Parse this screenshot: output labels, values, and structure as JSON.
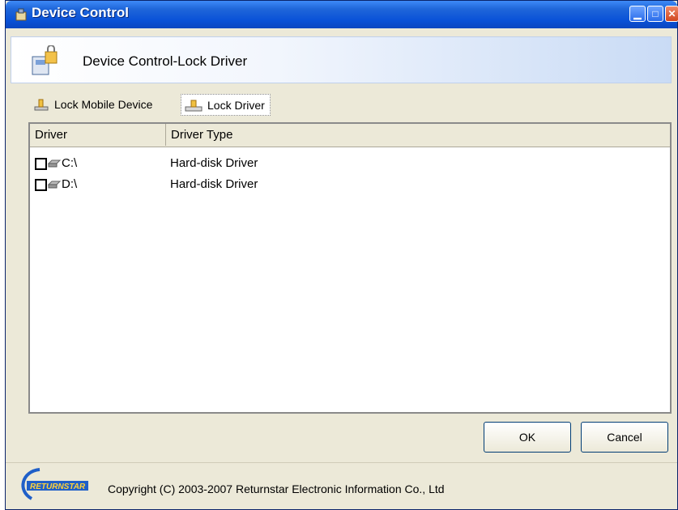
{
  "window": {
    "title": "Device Control"
  },
  "banner": {
    "title": "Device Control-Lock Driver"
  },
  "tabs": [
    {
      "label": "Lock Mobile Device",
      "selected": false
    },
    {
      "label": "Lock Driver",
      "selected": true
    }
  ],
  "list": {
    "columns": [
      "Driver",
      "Driver Type"
    ],
    "rows": [
      {
        "driver": "C:\\",
        "type": "Hard-disk Driver",
        "checked": false
      },
      {
        "driver": "D:\\",
        "type": "Hard-disk Driver",
        "checked": false
      }
    ]
  },
  "buttons": {
    "ok": "OK",
    "cancel": "Cancel"
  },
  "footer": {
    "copyright": "Copyright (C) 2003-2007 Returnstar Electronic Information Co., Ltd"
  },
  "colors": {
    "titlebar": "#0a52d8",
    "accent": "#3d8af7"
  }
}
